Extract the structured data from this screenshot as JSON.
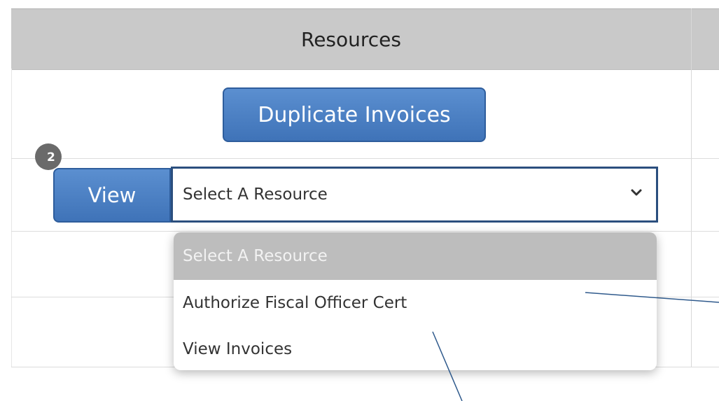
{
  "header": {
    "title": "Resources"
  },
  "buttons": {
    "duplicate_invoices": "Duplicate Invoices",
    "view": "View"
  },
  "badge": {
    "number": "2"
  },
  "select": {
    "value": "Select A Resource",
    "options": [
      "Select A Resource",
      "Authorize Fiscal Officer Cert",
      "View Invoices"
    ]
  },
  "colors": {
    "button_blue": "#4a7fc3",
    "header_gray": "#c9c9c9",
    "select_border": "#2b4f7e",
    "badge_gray": "#6a6a6a",
    "callout_line": "#2f5a8c"
  },
  "icons": {
    "select_arrow": "chevron-down-icon"
  }
}
